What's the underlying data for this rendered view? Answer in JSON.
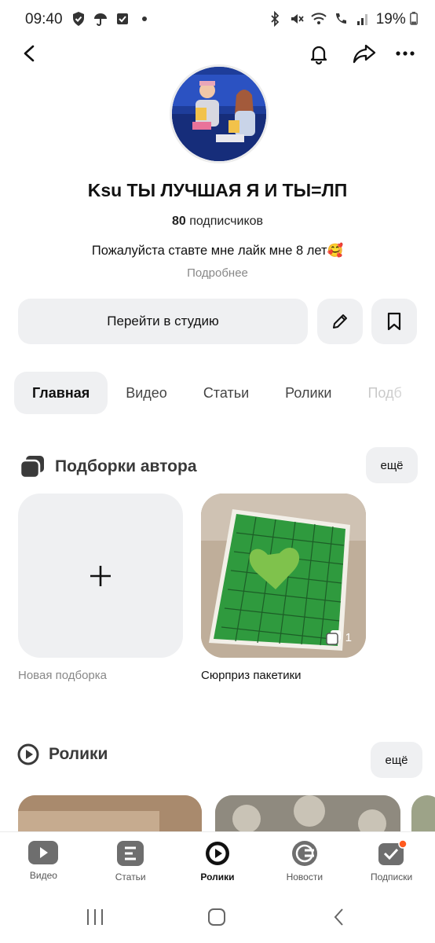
{
  "status": {
    "time": "09:40",
    "battery": "19%"
  },
  "channel": {
    "name": "Ksu ТЫ ЛУЧШАЯ Я И ТЫ=ЛП",
    "subs_count": "80",
    "subs_label": "подписчиков",
    "bio": "Пожалуйста ставте мне лайк мне 8 лет🥰",
    "more": "Подробнее"
  },
  "actions": {
    "studio": "Перейти в студию"
  },
  "tabs": [
    {
      "label": "Главная",
      "active": true
    },
    {
      "label": "Видео"
    },
    {
      "label": "Статьи"
    },
    {
      "label": "Ролики"
    },
    {
      "label": "Подб"
    }
  ],
  "collections": {
    "title": "Подборки автора",
    "more": "ещё",
    "items": [
      {
        "caption": "Новая подборка"
      },
      {
        "caption": "Сюрприз пакетики",
        "count": "1"
      }
    ]
  },
  "reels": {
    "title": "Ролики",
    "more": "ещё"
  },
  "bottom_nav": [
    {
      "label": "Видео"
    },
    {
      "label": "Статьи"
    },
    {
      "label": "Ролики",
      "active": true
    },
    {
      "label": "Новости"
    },
    {
      "label": "Подписки"
    }
  ],
  "colors": {
    "accent_badge": "#ff5a1f",
    "surface": "#eff0f2",
    "caption_gray": "#888888"
  }
}
